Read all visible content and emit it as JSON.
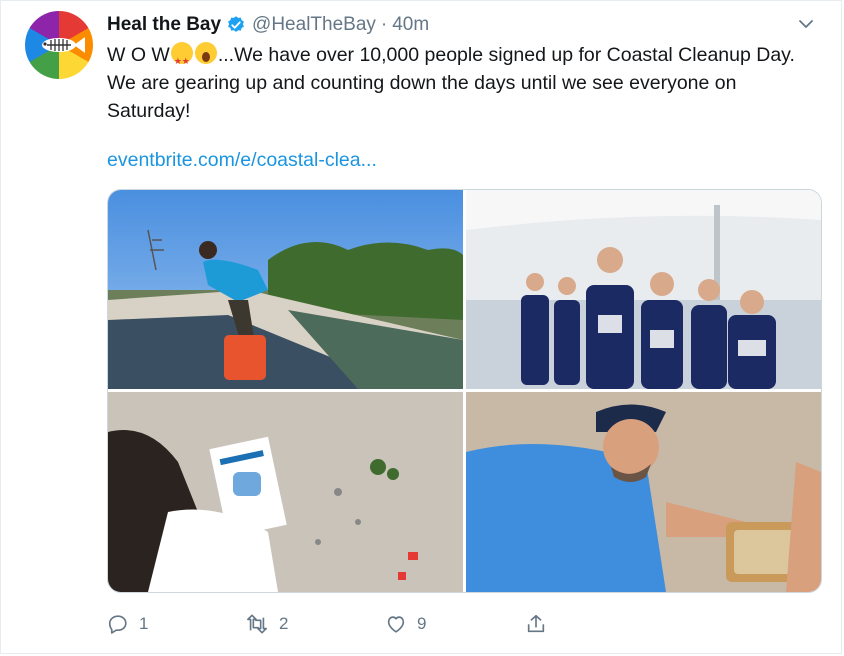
{
  "tweet": {
    "display_name": "Heal the Bay",
    "handle": "@HealTheBay",
    "separator": "·",
    "time": "40m",
    "text_prefix": "W O W",
    "text_body": "...We have over 10,000 people signed up for Coastal Cleanup Day. We are gearing up and counting down the days until we see everyone on Saturday!",
    "link": "eventbrite.com/e/coastal-clea...",
    "media": {
      "photos": [
        {
          "icon": "river-cleanup-photo"
        },
        {
          "icon": "volunteer-group-photo"
        },
        {
          "icon": "beach-debris-photo"
        },
        {
          "icon": "sifting-sand-photo"
        }
      ]
    },
    "actions": {
      "reply_count": "1",
      "retweet_count": "2",
      "like_count": "9"
    },
    "colors": {
      "link": "#1b95e0",
      "muted": "#657786",
      "verified": "#1da1f2"
    }
  }
}
